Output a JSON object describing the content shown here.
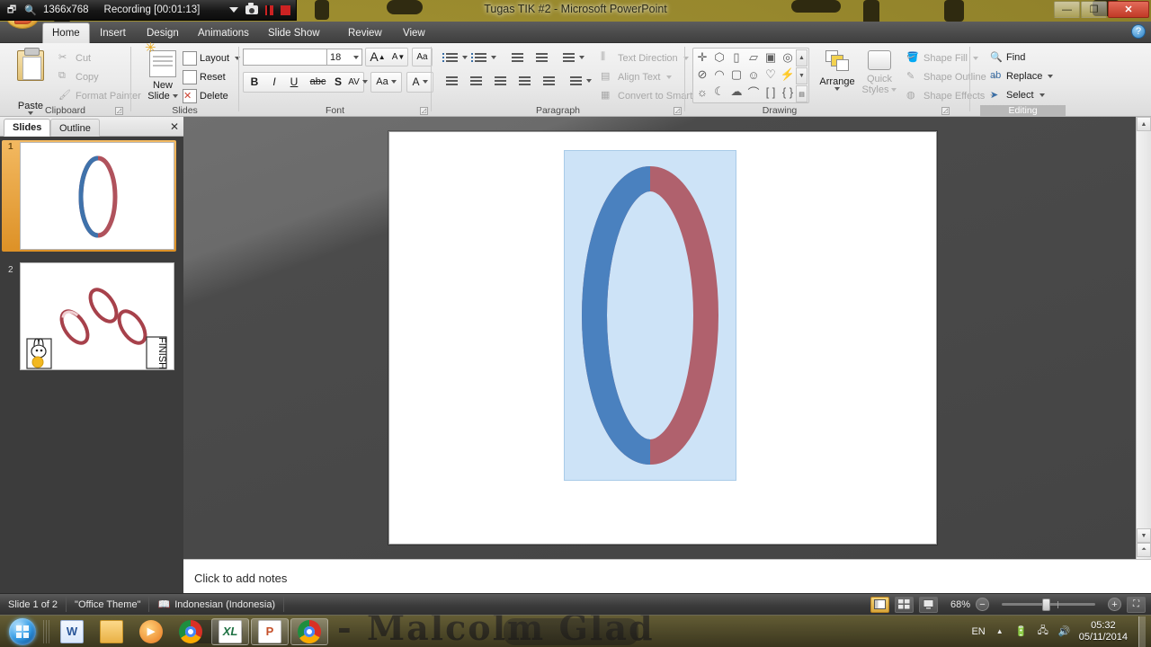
{
  "recorder": {
    "resolution": "1366x768",
    "status": "Recording [00:01:13]",
    "icons": [
      "window-icon",
      "magnifier-icon",
      "dropdown-arrow-icon",
      "camera-icon",
      "pause-icon",
      "stop-icon"
    ]
  },
  "window": {
    "title": "Tugas TIK #2 - Microsoft PowerPoint",
    "minimize_label": "—",
    "restore_label": "❐",
    "close_label": "✕",
    "help_label": "?"
  },
  "ribbon": {
    "tabs": [
      {
        "label": "Home",
        "active": true
      },
      {
        "label": "Insert",
        "active": false
      },
      {
        "label": "Design",
        "active": false
      },
      {
        "label": "Animations",
        "active": false
      },
      {
        "label": "Slide Show",
        "active": false
      },
      {
        "label": "Review",
        "active": false
      },
      {
        "label": "View",
        "active": false
      }
    ],
    "groups": {
      "clipboard": {
        "title": "Clipboard",
        "paste_label": "Paste",
        "items": [
          {
            "label": "Cut",
            "icon": "scissors-icon",
            "dim": true
          },
          {
            "label": "Copy",
            "icon": "copy-icon",
            "dim": true
          },
          {
            "label": "Format Painter",
            "icon": "format-painter-icon",
            "dim": true
          }
        ]
      },
      "slides": {
        "title": "Slides",
        "new_slide_label": "New\nSlide",
        "new_slide_line1": "New",
        "new_slide_line2": "Slide",
        "items": [
          {
            "label": "Layout",
            "icon": "layout-icon"
          },
          {
            "label": "Reset",
            "icon": "reset-icon"
          },
          {
            "label": "Delete",
            "icon": "delete-icon"
          }
        ]
      },
      "font": {
        "title": "Font",
        "font_name_value": "",
        "font_name_placeholder": "",
        "font_size_value": "18",
        "grow_font": "A",
        "shrink_font": "A",
        "clear_formatting": "Aa",
        "bold": "B",
        "italic": "I",
        "underline": "U",
        "strikethrough": "abc",
        "shadow": "S",
        "character_spacing": "AV",
        "change_case": "Aa",
        "font_color": "A"
      },
      "paragraph": {
        "title": "Paragraph",
        "text_direction": "Text Direction",
        "align_text": "Align Text",
        "convert_smartart": "Convert to SmartArt"
      },
      "drawing": {
        "title": "Drawing",
        "arrange": "Arrange",
        "quick_styles_line1": "Quick",
        "quick_styles_line2": "Styles",
        "shape_fill": "Shape Fill",
        "shape_outline": "Shape Outline",
        "shape_effects": "Shape Effects",
        "shapes": [
          "plus-shape",
          "heptagon-shape",
          "cylinder-shape",
          "cube-shape",
          "frame-shape",
          "donut-shape",
          "noentry-shape",
          "arc-shape",
          "square-shape",
          "smiley-shape",
          "heart-shape",
          "lightning-shape",
          "sun-shape",
          "moon-shape",
          "cloud-shape",
          "curve-shape",
          "bracket-shape",
          "brace-shape"
        ]
      },
      "editing": {
        "title": "Editing",
        "find": "Find",
        "replace": "Replace",
        "select": "Select"
      }
    }
  },
  "slides_pane": {
    "tab_slides": "Slides",
    "tab_outline": "Outline",
    "close_label": "✕",
    "thumbnails": [
      {
        "number": "1",
        "selected": true,
        "content": "blue-red-donut-ring"
      },
      {
        "number": "2",
        "selected": false,
        "content": "three-red-rings",
        "finish_label": "FINISH"
      }
    ]
  },
  "slide_editor": {
    "shape_rect_color": "#cde3f7",
    "ring_left_color": "#4a81bf",
    "ring_right_color": "#b5636e"
  },
  "notes": {
    "placeholder": "Click to add notes"
  },
  "statusbar": {
    "slide_counter": "Slide 1 of 2",
    "theme": "\"Office Theme\"",
    "language": "Indonesian (Indonesia)",
    "spellcheck_icon": "spellcheck-icon",
    "zoom_level": "68%",
    "views": [
      "normal-view",
      "slide-sorter-view",
      "reading-view"
    ],
    "zoom_out_label": "−",
    "zoom_in_label": "+",
    "fit_slide_label": "⛶"
  },
  "taskbar": {
    "start_label": "Start",
    "items": [
      {
        "name": "word",
        "label": "W",
        "running": false
      },
      {
        "name": "explorer",
        "label": "",
        "running": false
      },
      {
        "name": "media-player",
        "label": "▶",
        "running": false
      },
      {
        "name": "chrome",
        "label": "",
        "running": false
      },
      {
        "name": "excel",
        "label": "XL",
        "running": true
      },
      {
        "name": "powerpoint",
        "label": "P",
        "running": true
      },
      {
        "name": "chrome-window",
        "label": "",
        "running": true
      }
    ],
    "tray": {
      "language": "EN",
      "show_hidden_icons": "▲",
      "battery_icon": "battery-icon",
      "network_icon": "network-icon",
      "volume_icon": "volume-icon",
      "time": "05:32",
      "date": "05/11/2014"
    }
  },
  "wallpaper": {
    "text": "- Malcolm Glad",
    "color": "#9c8c2f"
  }
}
